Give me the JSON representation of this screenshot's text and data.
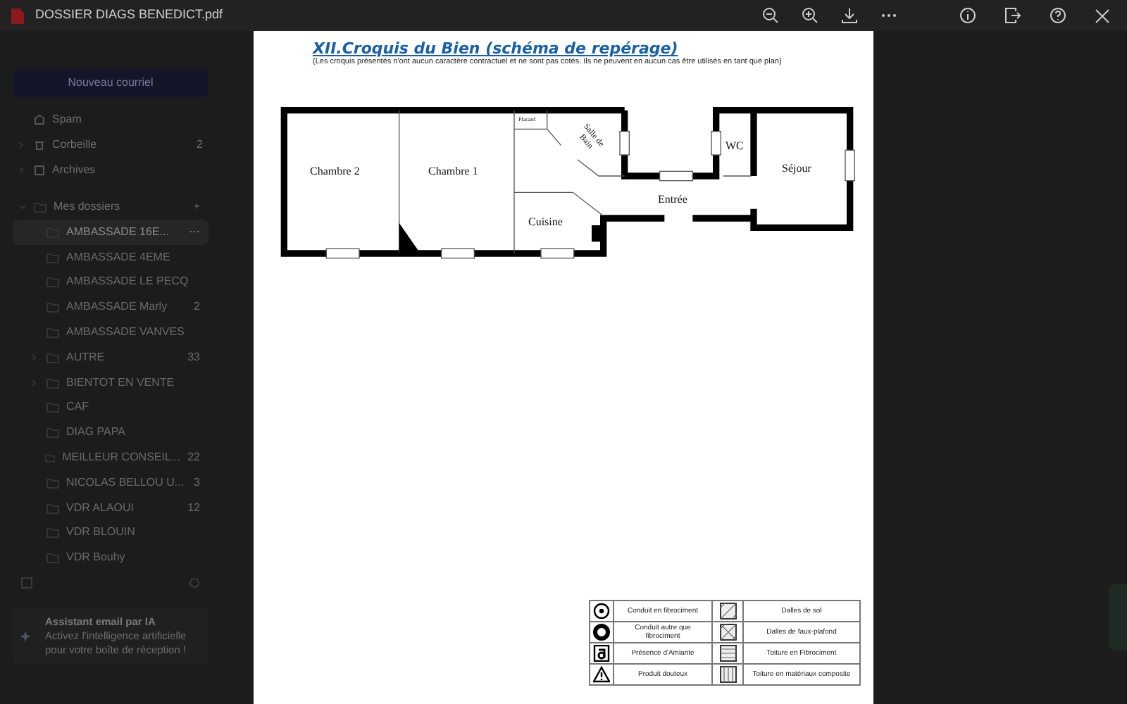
{
  "viewer": {
    "file_name": "DOSSIER DIAGS BENEDICT.pdf"
  },
  "sidebar": {
    "new_button": "Nouveau courriel",
    "items": [
      {
        "label": "Spam",
        "kind": "spam",
        "expandable": false
      },
      {
        "label": "Corbeille",
        "count": "2",
        "kind": "trash",
        "expandable": true
      },
      {
        "label": "Archives",
        "kind": "archive",
        "expandable": true
      }
    ],
    "folders": {
      "label": "Mes dossiers",
      "expanded": true,
      "add": "+",
      "children": [
        {
          "label": "AMBASSADE 16E...",
          "selected": true,
          "more": "⋯"
        },
        {
          "label": "AMBASSADE 4EME",
          "selected": false
        },
        {
          "label": "AMBASSADE LE PECQ",
          "selected": false
        },
        {
          "label": "AMBASSADE Marly",
          "count": "2",
          "selected": false
        },
        {
          "label": "AMBASSADE VANVES",
          "selected": false
        },
        {
          "label": "AUTRE",
          "count": "33",
          "selected": false,
          "expandable": true
        },
        {
          "label": "BIENTOT EN VENTE",
          "selected": false,
          "expandable": true
        },
        {
          "label": "CAF",
          "selected": false
        },
        {
          "label": "DIAG PAPA",
          "selected": false
        },
        {
          "label": "MEILLEUR CONSEIL...",
          "count": "22",
          "selected": false
        },
        {
          "label": "NICOLAS BELLOU U...",
          "count": "3",
          "selected": false
        },
        {
          "label": "VDR ALAOUI",
          "count": "12",
          "selected": false
        },
        {
          "label": "VDR BLOUIN",
          "selected": false
        },
        {
          "label": "VDR Bouhy",
          "selected": false
        }
      ]
    },
    "assistant": {
      "title": "Assistant email par IA",
      "text": "Activez l'intelligence artificielle pour votre boîte de réception !"
    }
  },
  "page": {
    "title": "XII.Croquis du Bien (schéma de repérage)",
    "note": "(Les croquis présentés n'ont aucun caractère contractuel et ne sont pas cotés. Ils ne peuvent en aucun cas être utilisés en tant que plan)",
    "rooms": [
      "Chambre 2",
      "Chambre 1",
      "Placard",
      "Salle de Bain",
      "Cuisine",
      "Entrée",
      "WC",
      "Séjour"
    ],
    "legend": [
      {
        "kind": "circle-dot",
        "label": "Conduit en fibrociment"
      },
      {
        "kind": "diagonal",
        "label": "Dalles de sol"
      },
      {
        "kind": "ring",
        "label": "Conduit autre que fibrociment"
      },
      {
        "kind": "cross",
        "label": "Dalles de faux-plafond"
      },
      {
        "kind": "letter",
        "label": "Présence d'Amiante"
      },
      {
        "kind": "horizontal",
        "label": "Toiture en Fibrociment"
      },
      {
        "kind": "warning",
        "label": "Produit douteux"
      },
      {
        "kind": "vertical",
        "label": "Toiture en matériaux composite"
      }
    ]
  }
}
